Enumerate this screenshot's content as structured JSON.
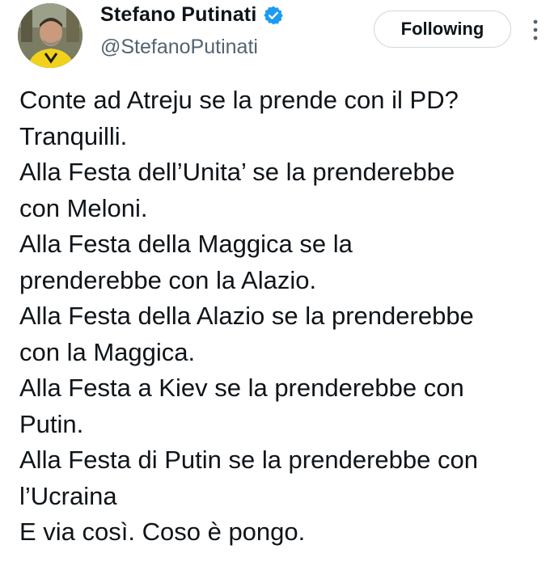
{
  "author": {
    "display_name": "Stefano Putinati",
    "handle": "@StefanoPutinati",
    "verified_icon": "verified-badge-icon",
    "avatar": "avatar-photo"
  },
  "follow_button": {
    "label": "Following"
  },
  "more_menu": {
    "icon": "more-vertical-icon"
  },
  "tweet": {
    "lines": [
      "Conte ad Atreju se la prende con il PD?",
      "Tranquilli.",
      "Alla Festa dell’Unita’ se la prenderebbe",
      "con Meloni.",
      "Alla Festa della Maggica se la",
      "prenderebbe con la Alazio.",
      "Alla Festa della Alazio se la prenderebbe",
      "con la Maggica.",
      "Alla Festa a Kiev se la prenderebbe con",
      "Putin.",
      "Alla Festa di Putin se la prenderebbe con",
      "l’Ucraina",
      "E via così. Coso è pongo."
    ]
  },
  "colors": {
    "verified": "#1d9bf0",
    "text": "#0f1419",
    "secondary_text": "#536471",
    "button_border": "#cfd9de"
  }
}
